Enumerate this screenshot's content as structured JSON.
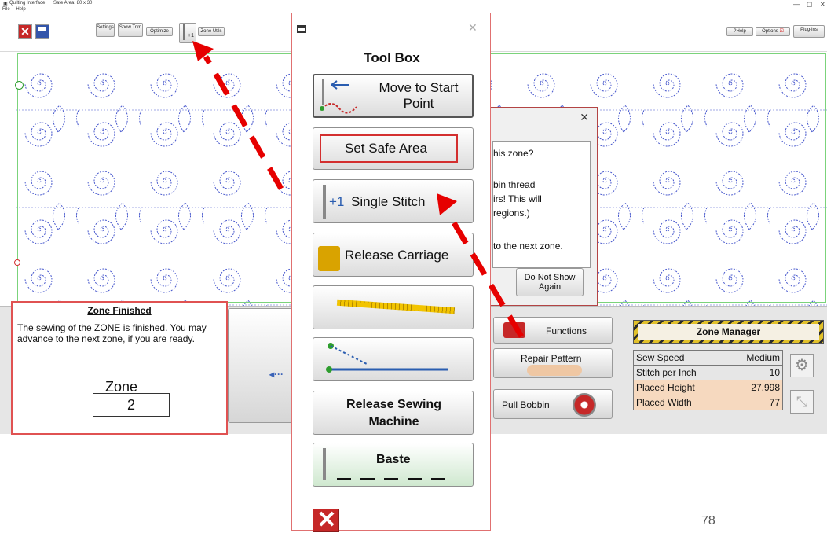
{
  "window": {
    "app_title": "Quilting Interface",
    "safe_area_label": "Safe Area: 80 x 30",
    "menu": [
      "File",
      "Help"
    ]
  },
  "toolbar": {
    "buttons": [
      {
        "label": "Settings"
      },
      {
        "label": "Show Trim"
      },
      {
        "label": "Optimize"
      },
      {
        "label": "+1"
      },
      {
        "label": "Zone Utils"
      }
    ],
    "right_buttons": [
      {
        "label": "?Help"
      },
      {
        "label": "Options"
      },
      {
        "label": "Plug-ins"
      }
    ]
  },
  "zone_finished": {
    "title": "Zone Finished",
    "message": "The sewing of the ZONE is finished. You may advance to the next zone, if you are ready.",
    "zone_label": "Zone",
    "zone_value": "2"
  },
  "bottom": {
    "functions_label": "Functions",
    "repair_label": "Repair Pattern",
    "pull_bobbin_label": "Pull Bobbin"
  },
  "zone_manager": {
    "title": "Zone Manager",
    "rows": [
      {
        "label": "Sew Speed",
        "value": "Medium",
        "highlight": false
      },
      {
        "label": "Stitch per Inch",
        "value": "10",
        "highlight": false
      },
      {
        "label": "Placed Height",
        "value": "27.998",
        "highlight": true
      },
      {
        "label": "Placed Width",
        "value": "77",
        "highlight": true
      }
    ]
  },
  "message_dialog": {
    "lines": [
      "his zone?",
      "bin thread",
      "irs! This will",
      "regions.)",
      "to the next zone."
    ],
    "do_not_show_label": "Do Not Show Again"
  },
  "toolbox": {
    "title": "Tool Box",
    "tools": [
      {
        "label": "Move to Start Point"
      },
      {
        "label": "Set Safe Area"
      },
      {
        "label": "Single Stitch",
        "badge": "+1"
      },
      {
        "label": "Release Carriage"
      },
      {
        "label": ""
      },
      {
        "label": ""
      },
      {
        "label": "Release Sewing Machine"
      },
      {
        "label": "Baste"
      }
    ]
  },
  "page_number": "78",
  "colors": {
    "accent_red": "#e60000",
    "stitch_blue": "#4455cc",
    "zone_manager_highlight": "#f6d9bf"
  }
}
